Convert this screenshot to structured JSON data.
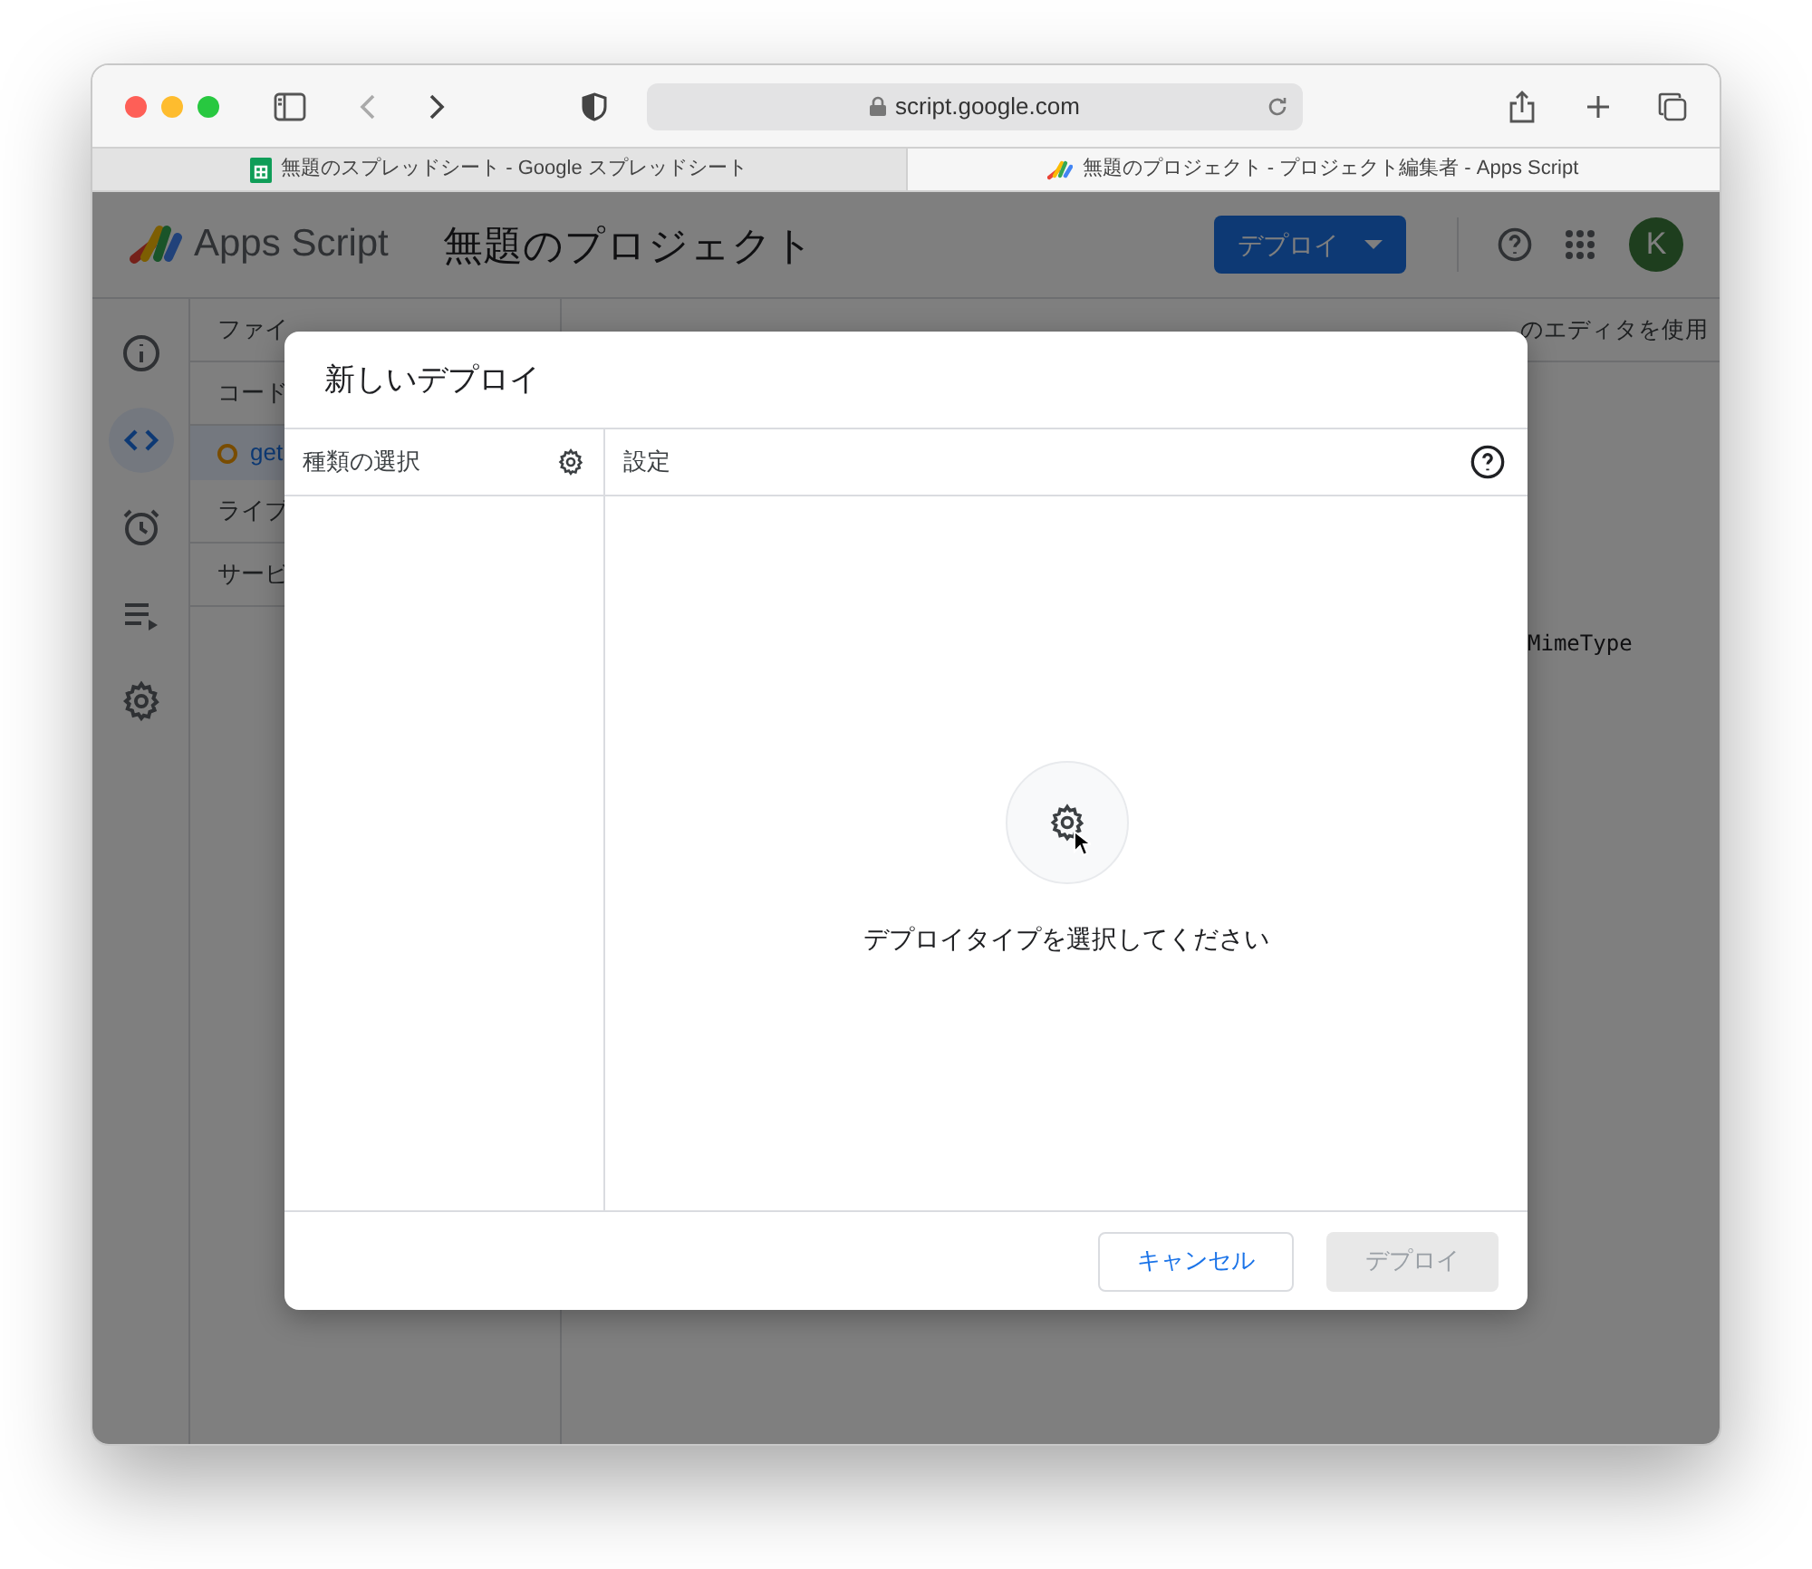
{
  "browser": {
    "url": "script.google.com",
    "tabs": [
      {
        "title": "無題のスプレッドシート - Google スプレッドシート",
        "kind": "sheets",
        "selected": false
      },
      {
        "title": "無題のプロジェクト - プロジェクト編集者 - Apps Script",
        "kind": "script",
        "selected": true
      }
    ]
  },
  "app": {
    "product": "Apps Script",
    "project_title": "無題のプロジェクト",
    "deploy_button": "デプロイ",
    "avatar": "K"
  },
  "rail": [
    {
      "kind": "info",
      "selected": false
    },
    {
      "kind": "code",
      "selected": true
    },
    {
      "kind": "triggers",
      "selected": false
    },
    {
      "kind": "executions",
      "selected": false
    },
    {
      "kind": "settings",
      "selected": false
    }
  ],
  "files_panel": {
    "header": "ファイ",
    "items": [
      {
        "kind": "section",
        "label": "コード"
      },
      {
        "kind": "file",
        "label": "get",
        "selected": true
      },
      {
        "kind": "section",
        "label": "ライブ"
      },
      {
        "kind": "section",
        "label": "サービ"
      }
    ]
  },
  "toolbar": {
    "legacy": "のエディタを使用"
  },
  "editor": {
    "code_fragment": "MimeType"
  },
  "dialog": {
    "title": "新しいデプロイ",
    "left_header": "種類の選択",
    "right_header": "設定",
    "empty_message": "デプロイタイプを選択してください",
    "buttons": [
      {
        "label": "キャンセル",
        "disabled": false
      },
      {
        "label": "デプロイ",
        "disabled": true
      }
    ]
  }
}
